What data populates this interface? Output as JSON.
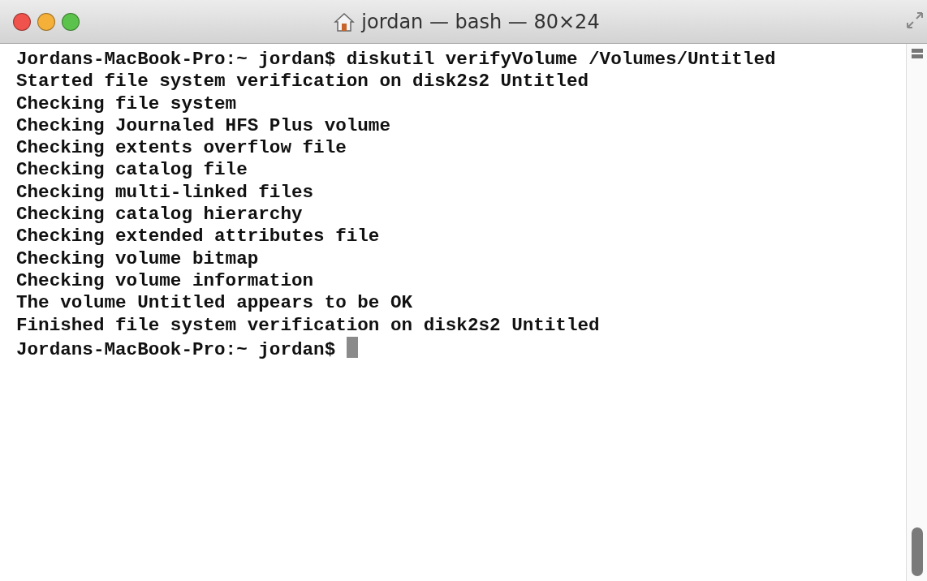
{
  "window": {
    "title": "jordan — bash — 80×24"
  },
  "terminal": {
    "lines": [
      "Jordans-MacBook-Pro:~ jordan$ diskutil verifyVolume /Volumes/Untitled",
      "Started file system verification on disk2s2 Untitled",
      "Checking file system",
      "Checking Journaled HFS Plus volume",
      "Checking extents overflow file",
      "Checking catalog file",
      "Checking multi-linked files",
      "Checking catalog hierarchy",
      "Checking extended attributes file",
      "Checking volume bitmap",
      "Checking volume information",
      "The volume Untitled appears to be OK",
      "Finished file system verification on disk2s2 Untitled",
      "Jordans-MacBook-Pro:~ jordan$ "
    ],
    "cursor_visible": true
  }
}
